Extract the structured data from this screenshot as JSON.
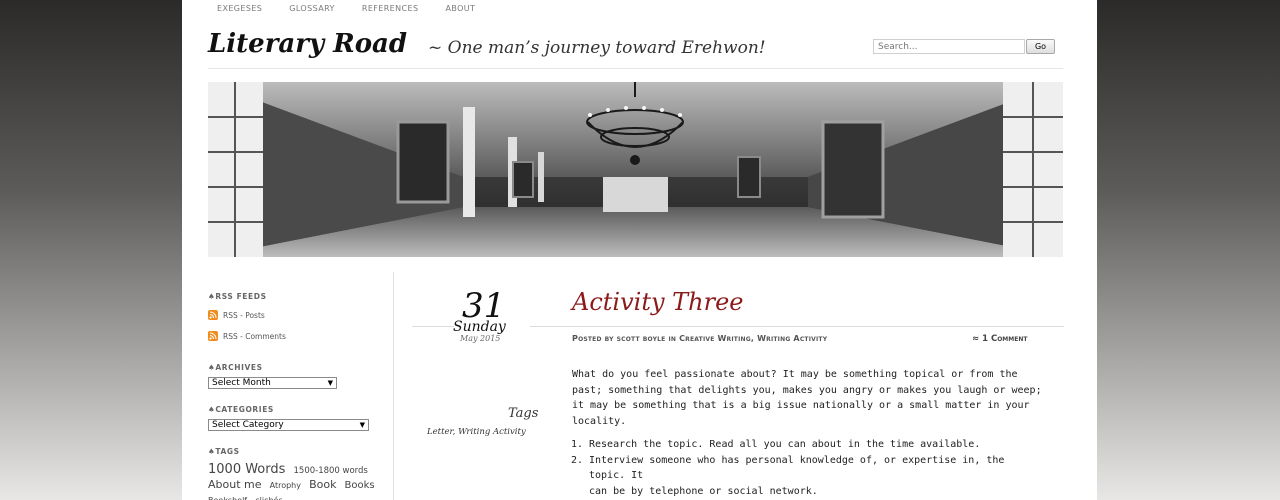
{
  "nav": [
    "EXEGESES",
    "GLOSSARY",
    "REFERENCES",
    "ABOUT"
  ],
  "header": {
    "title": "Literary Road",
    "tagline": "~ One man’s journey toward Erehwon!"
  },
  "search": {
    "placeholder": "Search...",
    "button": "Go"
  },
  "sidebar": {
    "rss_title": "RSS FEEDS",
    "rss_posts": "RSS - Posts",
    "rss_comments": "RSS - Comments",
    "archives_title": "ARCHIVES",
    "archives_select": "Select Month",
    "categories_title": "CATEGORIES",
    "categories_select": "Select Category",
    "tags_title": "TAGS",
    "tags": [
      {
        "text": "1000 Words",
        "size": 13
      },
      {
        "text": "1500-1800 words",
        "size": 8.5
      },
      {
        "text": "About me",
        "size": 11
      },
      {
        "text": "Atrophy",
        "size": 8
      },
      {
        "text": "Book",
        "size": 11
      },
      {
        "text": "Books",
        "size": 10
      },
      {
        "text": "Bookshelf",
        "size": 8
      },
      {
        "text": "clichés",
        "size": 8
      }
    ]
  },
  "post": {
    "date_day": "31",
    "date_weekday": "Sunday",
    "date_month": "May 2015",
    "title": "Activity Three",
    "meta": "Posted by scott boyle in Creative Writing, Writing Activity",
    "comments": "≈ 1 Comment",
    "tags_label": "Tags",
    "tags": "Letter, Writing Activity",
    "intro": "What do you feel passionate about? It may be something topical or from the past; something that delights you, makes you angry or makes you laugh or weep; it may be something that is a big issue nationally or a small matter in your locality.",
    "steps": [
      "Research the topic. Read all you can about in the time available.",
      "Interview someone who has personal knowledge of, or expertise in, the topic. It\ncan be by telephone or social network."
    ]
  },
  "colors": {
    "title_red": "#8b1a1a",
    "rss_orange": "#f08c1e"
  }
}
